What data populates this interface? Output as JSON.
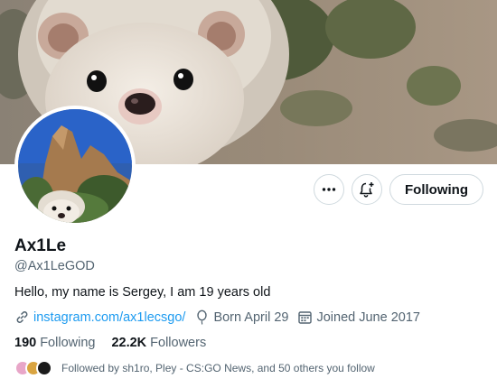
{
  "profile": {
    "name": "Ax1Le",
    "handle": "@Ax1LeGOD",
    "bio": "Hello, my name is Sergey, I am 19 years old",
    "website": "instagram.com/ax1lecsgo/",
    "birthday": "Born April 29",
    "joined": "Joined June 2017"
  },
  "actions": {
    "more_icon": "more-icon",
    "notify_icon": "bell-plus-icon",
    "follow_label": "Following"
  },
  "stats": {
    "following_count": "190",
    "following_label": "Following",
    "followers_count": "22.2K",
    "followers_label": "Followers"
  },
  "followed_by": {
    "text": "Followed by sh1ro, Pley - CS:GO News, and 50 others you follow"
  },
  "colors": {
    "link": "#1d9bf0",
    "secondary_text": "#536471",
    "border": "#cfd9de"
  }
}
